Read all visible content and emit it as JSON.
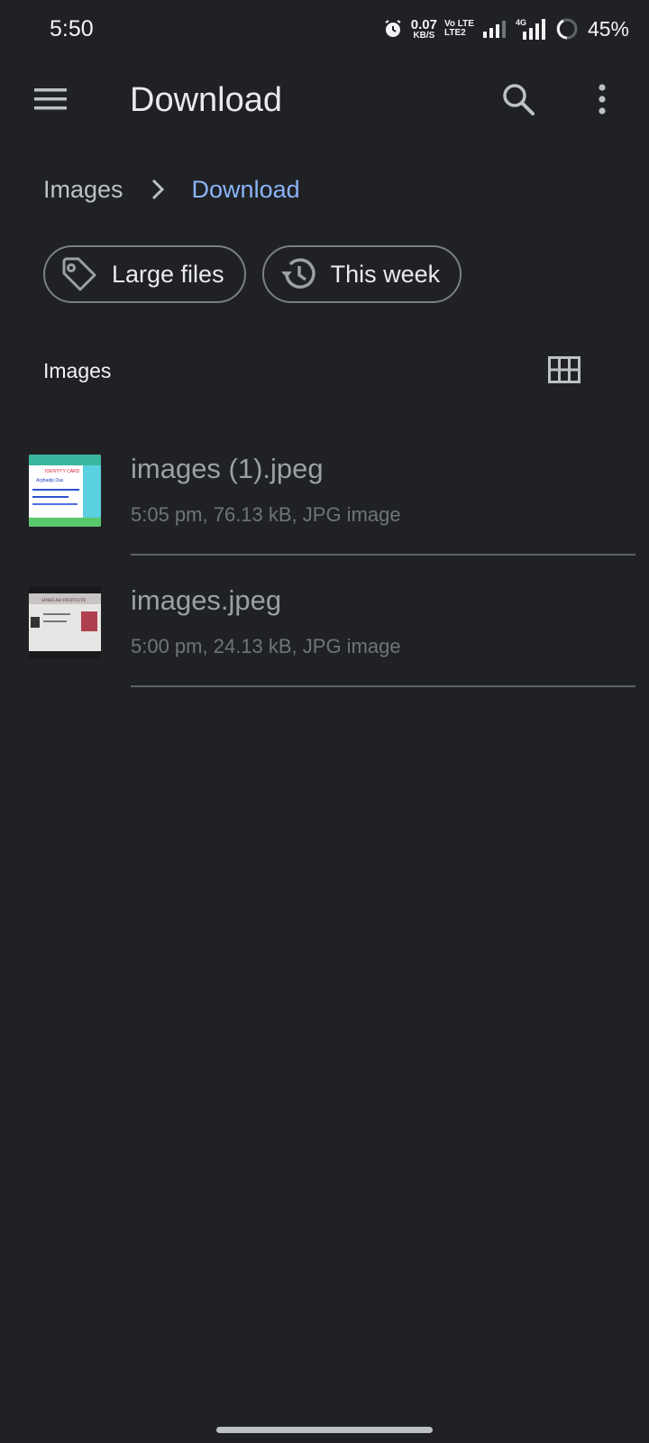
{
  "status_bar": {
    "time": "5:50",
    "net_speed_value": "0.07",
    "net_speed_unit": "KB/S",
    "volte_top": "Vo LTE",
    "volte_bottom": "LTE2",
    "network_type": "4G",
    "battery_percent": "45%"
  },
  "app_bar": {
    "title": "Download",
    "menu_icon": "hamburger-menu-icon",
    "search_icon": "search-icon",
    "more_icon": "more-vert-icon"
  },
  "breadcrumb": {
    "parent": "Images",
    "current": "Download"
  },
  "chips": [
    {
      "label": "Large files",
      "icon": "tag-icon"
    },
    {
      "label": "This week",
      "icon": "history-icon"
    }
  ],
  "section": {
    "title": "Images",
    "view_toggle_icon": "grid-view-icon"
  },
  "files": [
    {
      "name": "images (1).jpeg",
      "meta": "5:05 pm, 76.13 kB, JPG image",
      "thumb_text_1": "IDENTITY CARD",
      "thumb_text_2": "Arghadip Das"
    },
    {
      "name": "images.jpeg",
      "meta": "5:00 pm, 24.13 kB, JPG image",
      "thumb_text_1": "SINHGAD INSTITUTE"
    }
  ],
  "colors": {
    "background": "#202124",
    "accent": "#8ab4f8",
    "text_primary": "#e8eaed",
    "text_secondary": "#9aa0a6"
  }
}
